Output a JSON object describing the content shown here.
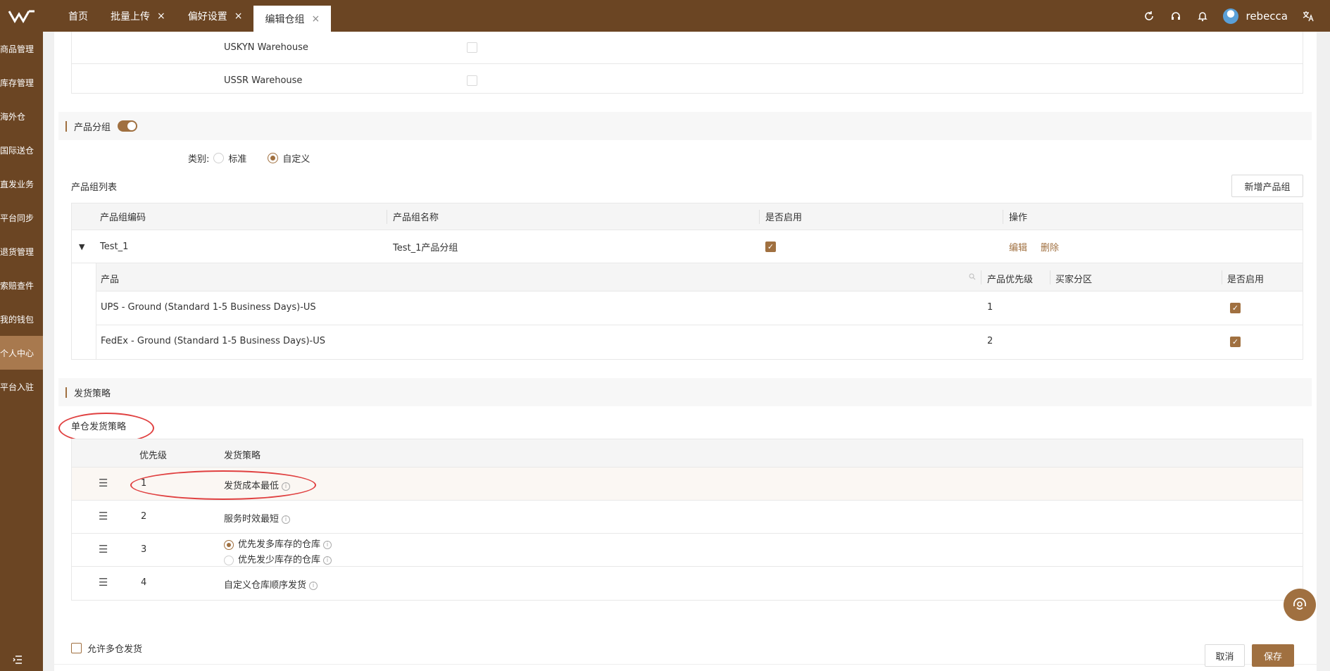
{
  "topbar": {
    "tabs": [
      {
        "label": "首页",
        "closable": false,
        "active": false
      },
      {
        "label": "批量上传",
        "closable": true,
        "active": false
      },
      {
        "label": "偏好设置",
        "closable": true,
        "active": false
      },
      {
        "label": "编辑仓组",
        "closable": true,
        "active": true
      }
    ],
    "close_glyph": "×",
    "user_name": "rebecca",
    "icons": [
      "refresh-icon",
      "headset-icon",
      "bell-icon",
      "translate-icon"
    ]
  },
  "sidebar": {
    "items": [
      {
        "label": "商品管理"
      },
      {
        "label": "库存管理"
      },
      {
        "label": "海外仓"
      },
      {
        "label": "国际送仓"
      },
      {
        "label": "直发业务"
      },
      {
        "label": "平台同步"
      },
      {
        "label": "退货管理"
      },
      {
        "label": "索赔查件"
      },
      {
        "label": "我的钱包"
      },
      {
        "label": "个人中心",
        "active": true
      },
      {
        "label": "平台入驻"
      }
    ]
  },
  "warehouses": [
    {
      "name": "USKYN Warehouse",
      "checked": false
    },
    {
      "name": "USSR Warehouse",
      "checked": false
    }
  ],
  "product_group": {
    "section_title": "产品分组",
    "enabled": true,
    "type_label": "类别:",
    "type_options": [
      {
        "label": "标准",
        "selected": false
      },
      {
        "label": "自定义",
        "selected": true
      }
    ],
    "list_title": "产品组列表",
    "add_button": "新增产品组",
    "columns": [
      "产品组编码",
      "产品组名称",
      "是否启用",
      "操作"
    ],
    "rows": [
      {
        "code": "Test_1",
        "name": "Test_1产品分组",
        "enabled": true,
        "actions": [
          "编辑",
          "删除"
        ],
        "sub_columns": [
          "产品",
          "产品优先级",
          "买家分区",
          "是否启用"
        ],
        "products": [
          {
            "name": "UPS - Ground (Standard 1-5 Business Days)-US",
            "priority": "1",
            "region": "",
            "enabled": true
          },
          {
            "name": "FedEx - Ground (Standard 1-5 Business Days)-US",
            "priority": "2",
            "region": "",
            "enabled": true
          }
        ]
      }
    ]
  },
  "shipping": {
    "section_title": "发货策略",
    "single_title": "单仓发货策略",
    "columns": [
      "优先级",
      "发货策略"
    ],
    "rows": [
      {
        "priority": "1",
        "strategy": "发货成本最低"
      },
      {
        "priority": "2",
        "strategy": "服务时效最短"
      },
      {
        "priority": "3",
        "options": [
          {
            "label": "优先发多库存的仓库",
            "selected": true
          },
          {
            "label": "优先发少库存的仓库",
            "selected": false
          }
        ]
      },
      {
        "priority": "4",
        "strategy": "自定义仓库顺序发货"
      }
    ],
    "allow_multi": "允许多仓发货"
  },
  "footer": {
    "cancel": "取消",
    "save": "保存"
  },
  "colors": {
    "brand": "#6b4523",
    "accent": "#a07040",
    "highlight": "#e04040"
  }
}
